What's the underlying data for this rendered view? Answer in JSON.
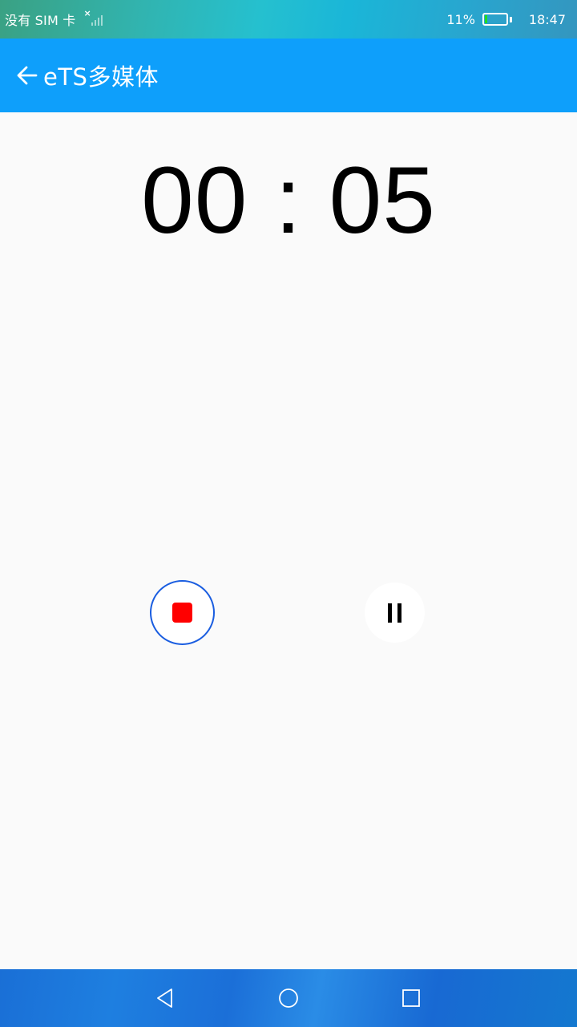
{
  "status_bar": {
    "sim_text": "没有 SIM 卡",
    "signal_icon": "no-signal-icon",
    "battery_percent": "11%",
    "time": "18:47",
    "battery_color": "#22dd22"
  },
  "app_bar": {
    "back_icon": "arrow-left-icon",
    "title": "eTS多媒体",
    "background": "#0e9ffb"
  },
  "recorder": {
    "timer": "00 : 05",
    "stop_icon": "stop-icon",
    "stop_color": "#ff0000",
    "pause_icon": "pause-icon"
  },
  "nav_bar": {
    "back_icon": "nav-back-icon",
    "home_icon": "nav-home-icon",
    "recents_icon": "nav-recents-icon"
  }
}
